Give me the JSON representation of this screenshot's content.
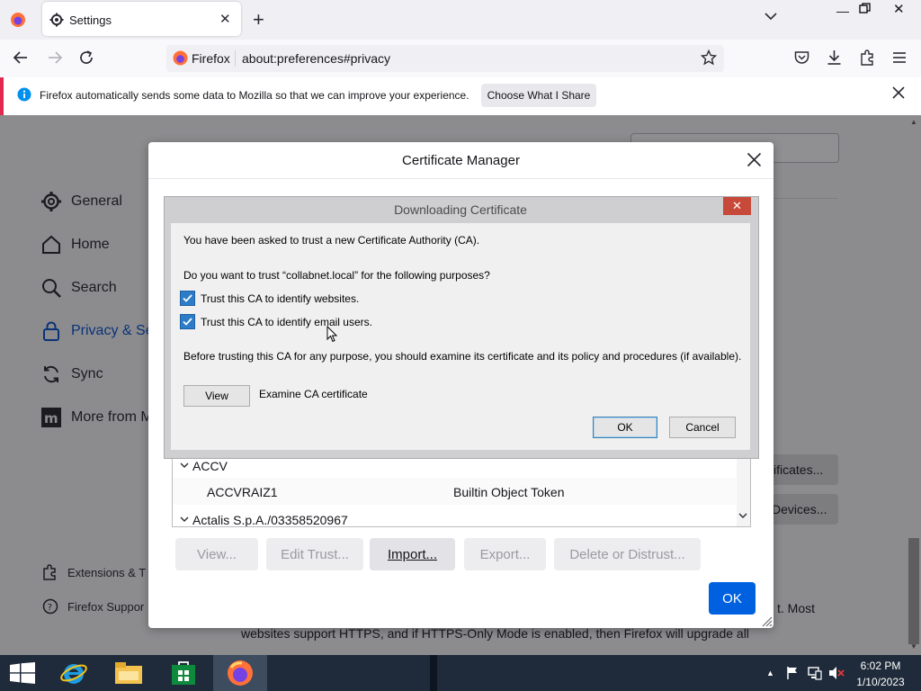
{
  "browser": {
    "tab_title": "Settings",
    "url_identity": "Firefox",
    "url": "about:preferences#privacy"
  },
  "infobar": {
    "message": "Firefox automatically sends some data to Mozilla so that we can improve your experience.",
    "button_label": "Choose What I Share"
  },
  "sidebar": {
    "items": [
      {
        "label": "General",
        "icon": "gear-icon"
      },
      {
        "label": "Home",
        "icon": "home-icon"
      },
      {
        "label": "Search",
        "icon": "search-icon"
      },
      {
        "label": "Privacy & Se",
        "icon": "lock-icon"
      },
      {
        "label": "Sync",
        "icon": "sync-icon"
      },
      {
        "label": "More from M",
        "icon": "mozilla-icon"
      }
    ],
    "footer": [
      {
        "label": "Extensions & T",
        "icon": "puzzle-icon"
      },
      {
        "label": "Firefox Suppor",
        "icon": "help-icon"
      }
    ]
  },
  "page_fragments": {
    "right_btn1": "ificates...",
    "right_btn2": "Devices...",
    "para_line1": "t. Most",
    "para_line2": "websites support HTTPS, and if HTTPS-Only Mode is enabled, then Firefox will upgrade all"
  },
  "cert_manager": {
    "title": "Certificate Manager",
    "tree": {
      "group1": "ACCV",
      "row_name": "ACCVRAIZ1",
      "row_device": "Builtin Object Token",
      "group2": "Actalis S.p.A./03358520967"
    },
    "buttons": {
      "view": "View...",
      "edit_trust": "Edit Trust...",
      "import": "Import...",
      "export": "Export...",
      "delete": "Delete or Distrust..."
    },
    "ok_label": "OK",
    "accent": "#0061e0"
  },
  "download_dialog": {
    "title": "Downloading Certificate",
    "intro": "You have been asked to trust a new Certificate Authority (CA).",
    "question": "Do you want to trust “collabnet.local” for the following purposes?",
    "check_websites": "Trust this CA to identify websites.",
    "check_email": "Trust this CA to identify email users.",
    "warning": "Before trusting this CA for any purpose, you should examine its certificate and its policy and procedures (if available).",
    "view_label": "View",
    "examine_label": "Examine CA certificate",
    "ok_label": "OK",
    "cancel_label": "Cancel"
  },
  "taskbar": {
    "time": "6:02 PM",
    "date": "1/10/2023"
  }
}
